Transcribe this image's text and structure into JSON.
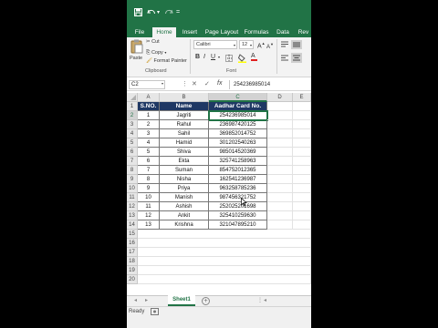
{
  "quick_access": {
    "more": "="
  },
  "ribbon_tabs": [
    "File",
    "Home",
    "Insert",
    "Page Layout",
    "Formulas",
    "Data",
    "Rev"
  ],
  "active_tab": "Home",
  "clipboard": {
    "paste": "Paste",
    "cut": "Cut",
    "copy": "Copy",
    "format_painter": "Format Painter",
    "group_label": "Clipboard"
  },
  "font": {
    "name": "Calibri",
    "size": "12",
    "grow": "A",
    "shrink": "A",
    "bold": "B",
    "italic": "I",
    "underline": "U",
    "font_color": "A",
    "group_label": "Font"
  },
  "formula_bar": {
    "name_box": "C2",
    "fx": "fx",
    "value": "254236985014"
  },
  "columns": [
    "A",
    "B",
    "C",
    "D",
    "E"
  ],
  "selected_cell": {
    "col": "C",
    "row": 2
  },
  "table": {
    "headers": [
      "S.NO.",
      "Name",
      "Aadhar Card No."
    ],
    "rows": [
      [
        "1",
        "Jagriti",
        "254236985014"
      ],
      [
        "2",
        "Rahul",
        "236987420125"
      ],
      [
        "3",
        "Sahil",
        "369852014752"
      ],
      [
        "4",
        "Hamid",
        "301202540263"
      ],
      [
        "5",
        "Shiva",
        "985014520369"
      ],
      [
        "6",
        "Ekta",
        "325741258963"
      ],
      [
        "7",
        "Suman",
        "854752012365"
      ],
      [
        "8",
        "Nisha",
        "162541236987"
      ],
      [
        "9",
        "Priya",
        "963258785236"
      ],
      [
        "10",
        "Manish",
        "987456321752"
      ],
      [
        "11",
        "Ashish",
        "252025201698"
      ],
      [
        "12",
        "Ankit",
        "325410259630"
      ],
      [
        "13",
        "Krishna",
        "321047895210"
      ]
    ]
  },
  "empty_rows": [
    "15",
    "16",
    "17",
    "18",
    "19",
    "20"
  ],
  "sheet_tabs": [
    "Sheet1"
  ],
  "status": "Ready",
  "colors": {
    "excel_green": "#217346",
    "header_fill": "#1f3864"
  }
}
